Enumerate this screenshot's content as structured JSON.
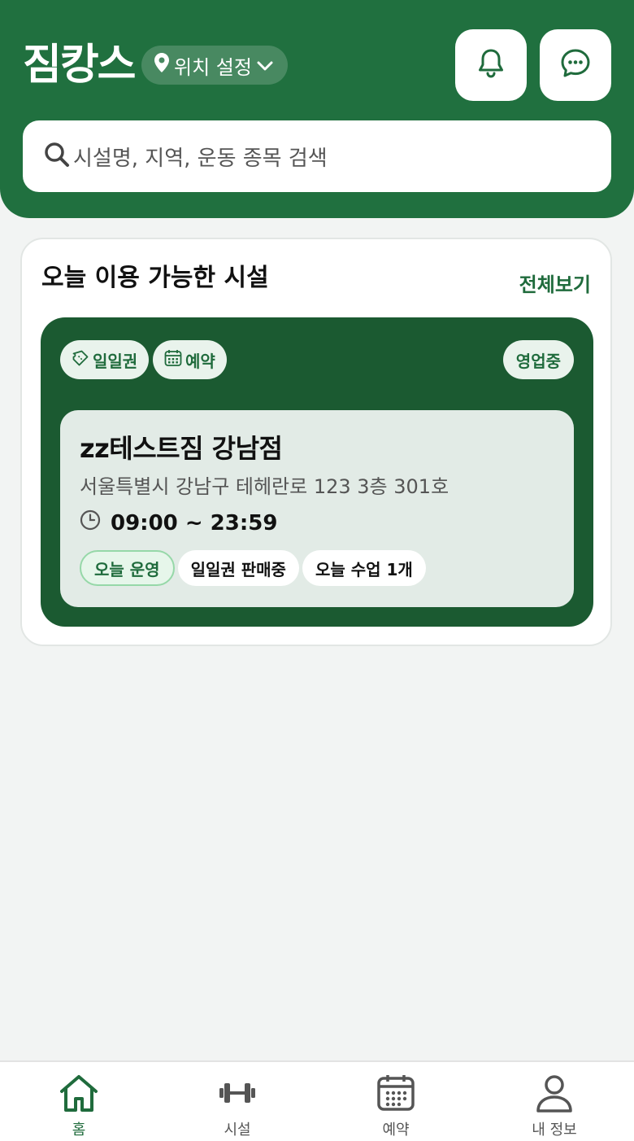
{
  "header": {
    "app_title": "짐캉스",
    "location_label": "위치 설정",
    "notification_icon": "bell-icon",
    "message_icon": "chat-bubble-icon"
  },
  "search": {
    "placeholder": "시설명, 지역, 운동 종목 검색"
  },
  "section": {
    "title": "오늘 이용 가능한 시설",
    "see_all": "전체보기"
  },
  "facility": {
    "badges": [
      "일일권",
      "예약"
    ],
    "status": "영업중",
    "name": "zz테스트짐 강남점",
    "address": "서울특별시 강남구 테헤란로 123 3층 301호",
    "hours": "09:00 ~ 23:59",
    "tags": [
      "오늘 운영",
      "일일권 판매중",
      "오늘 수업 1개"
    ]
  },
  "bottom_nav": {
    "items": [
      {
        "label": "홈",
        "icon": "home-icon",
        "active": true
      },
      {
        "label": "시설",
        "icon": "dumbbell-icon",
        "active": false
      },
      {
        "label": "예약",
        "icon": "calendar-icon",
        "active": false
      },
      {
        "label": "내 정보",
        "icon": "user-icon",
        "active": false
      }
    ]
  },
  "colors": {
    "primary": "#20703f",
    "card_dark": "#1b5a31",
    "accent_text": "#1f6b3c",
    "background": "#f2f4f3"
  }
}
